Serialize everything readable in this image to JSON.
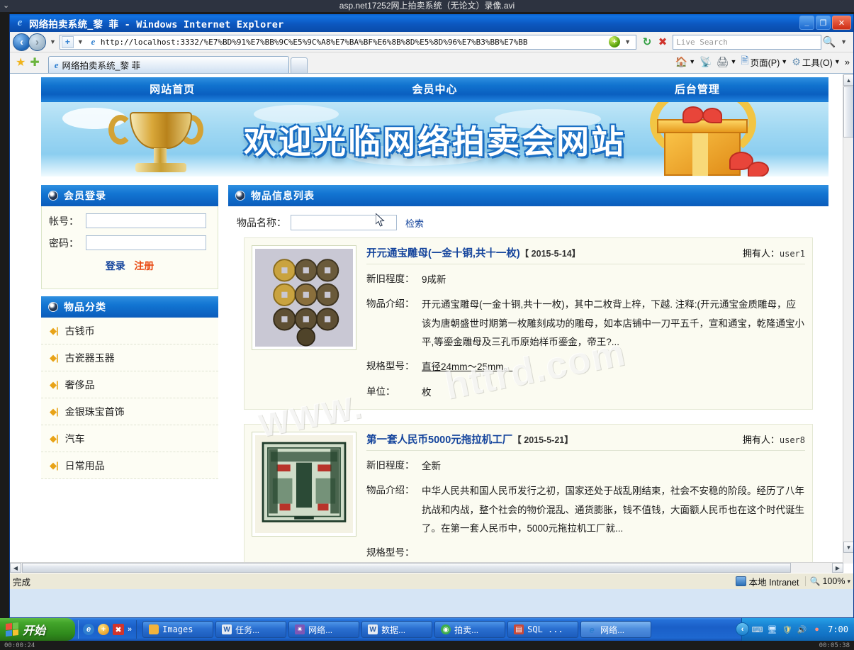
{
  "video": {
    "caption": "asp.net17252网上拍卖系统（无论文）录像.avi",
    "caret": "⌄",
    "time_left": "00:00:24",
    "time_right": "00:05:38"
  },
  "browser": {
    "title": "网络拍卖系统_黎 菲 - Windows Internet Explorer",
    "title_icon": "ie-logo-icon",
    "window_buttons": {
      "minimize": "_",
      "restore": "❐",
      "close": "✕"
    },
    "address": {
      "url": "http://localhost:3332/%E7%BD%91%E7%BB%9C%E5%9C%A8%E7%BA%BF%E6%8B%8D%E5%8D%96%E7%B3%BB%E7%BB",
      "back_icon": "back-arrow-icon",
      "forward_icon": "forward-arrow-icon",
      "recent_icon": "recent-pages-icon",
      "refresh_icon": "refresh-icon",
      "stop_icon": "stop-icon"
    },
    "search": {
      "placeholder": "Live Search",
      "icon": "search-icon"
    },
    "tab": {
      "label": "网络拍卖系统_黎 菲",
      "new_tab_label": ""
    },
    "favorites": {
      "star_icon": "favorites-star-icon",
      "add_icon": "add-to-favorites-icon"
    },
    "commands": [
      {
        "label": "",
        "icon": "home-icon",
        "caret": "▾"
      },
      {
        "label": "",
        "icon": "feeds-icon",
        "caret": ""
      },
      {
        "label": "",
        "icon": "print-icon",
        "caret": "▾"
      },
      {
        "label": "页面(P)",
        "icon": "page-icon",
        "caret": "▾"
      },
      {
        "label": "工具(O)",
        "icon": "tools-gear-icon",
        "caret": "▾"
      }
    ],
    "commands_overflow": "»",
    "status": {
      "text": "完成",
      "zone": "本地 Intranet",
      "zone_icon": "security-zone-icon",
      "zoom": "100%",
      "zoom_caret": "▾"
    }
  },
  "site": {
    "nav": [
      {
        "label": "网站首页"
      },
      {
        "label": "会员中心"
      },
      {
        "label": "后台管理"
      }
    ],
    "banner": {
      "title": "欢迎光临网络拍卖会网站"
    },
    "watermark_1": "WWW.",
    "watermark_2": "httrd.com",
    "login_panel": {
      "title": "会员登录",
      "fields": [
        {
          "label": "帐号：",
          "value": "",
          "name": "account"
        },
        {
          "label": "密码：",
          "value": "",
          "name": "password"
        }
      ],
      "login_link": "登录",
      "register_link": "注册"
    },
    "category_panel": {
      "title": "物品分类",
      "items": [
        {
          "label": "古钱币"
        },
        {
          "label": "古瓷器玉器"
        },
        {
          "label": "奢侈品"
        },
        {
          "label": "金银珠宝首饰"
        },
        {
          "label": "汽车"
        },
        {
          "label": "日常用品"
        }
      ]
    },
    "goods_panel": {
      "title": "物品信息列表",
      "search_label": "物品名称：",
      "search_value": "",
      "search_button": "检索",
      "owner_label": "拥有人：",
      "rows": {
        "condition": "新旧程度：",
        "intro": "物品介绍：",
        "spec": "规格型号：",
        "unit": "单位："
      },
      "items": [
        {
          "title": "开元通宝雕母(一金十铜,共十一枚)",
          "date": "【 2015-5-14】",
          "owner": "user1",
          "condition": "9成新",
          "intro": "开元通宝雕母(一金十铜,共十一枚)，其中二枚背上梓，下越. 注释:(开元通宝金质雕母，应该为唐朝盛世时期第一枚雕刻成功的雕母，如本店铺中一刀平五千，宣和通宝，乾隆通宝小平,等鎏金雕母及三孔币原始样币鎏金，帝王?...",
          "spec": "直径24mm～25mm。",
          "unit": "枚",
          "thumb": "ancient-coins-photo"
        },
        {
          "title": "第一套人民币5000元拖拉机工厂",
          "date": "【 2015-5-21】",
          "owner": "user8",
          "condition": "全新",
          "intro": "中华人民共和国人民币发行之初，国家还处于战乱刚结束，社会不安稳的阶段。经历了八年抗战和内战，整个社会的物价混乱、通货膨胀，钱不值钱，大面额人民币也在这个时代诞生了。在第一套人民币中，5000元拖拉机工厂就...",
          "spec": "",
          "unit": "",
          "thumb": "banknote-photo"
        }
      ]
    }
  },
  "taskbar": {
    "start_label": "开始",
    "quicklaunch": [
      {
        "name": "ie-quicklaunch-icon",
        "glyph": "e",
        "color": "#2f7fd0"
      },
      {
        "name": "media-quicklaunch-icon",
        "glyph": "+",
        "color": "#e8a21a"
      },
      {
        "name": "desktop-quicklaunch-icon",
        "glyph": "✕",
        "color": "#d0342c"
      }
    ],
    "quicklaunch_chevron": "»",
    "tasks": [
      {
        "label": "Images",
        "icon": "folder-icon",
        "active": false
      },
      {
        "label": "任务...",
        "icon": "word-doc-icon",
        "active": false
      },
      {
        "label": "网络...",
        "icon": "vs-project-icon",
        "active": false
      },
      {
        "label": "数据...",
        "icon": "word-doc-icon",
        "active": false
      },
      {
        "label": "拍卖...",
        "icon": "browser-icon",
        "active": false
      },
      {
        "label": "SQL ...",
        "icon": "sql-server-icon",
        "active": false
      },
      {
        "label": "网络...",
        "icon": "ie-icon",
        "active": true
      }
    ],
    "tray": {
      "chevron": "‹",
      "icons": [
        {
          "name": "keyboard-layout-icon",
          "glyph": "⌨"
        },
        {
          "name": "network-activity-icon",
          "glyph": "⛭"
        },
        {
          "name": "update-shield-icon",
          "glyph": "↻"
        },
        {
          "name": "volume-icon",
          "glyph": "♪"
        },
        {
          "name": "antivirus-icon",
          "glyph": "●"
        }
      ],
      "clock": "7:00"
    }
  }
}
